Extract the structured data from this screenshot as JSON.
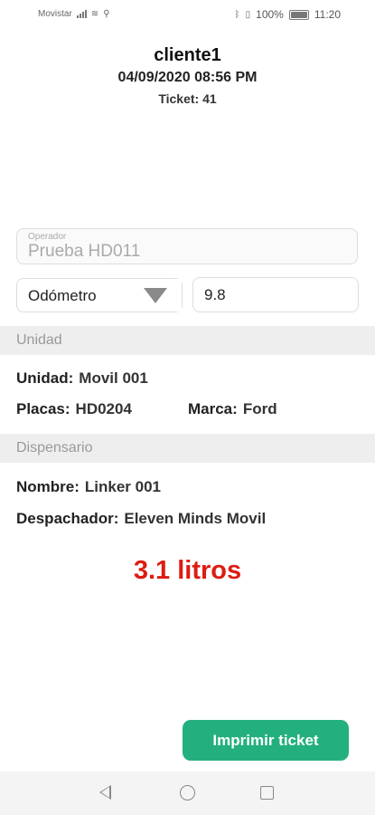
{
  "status_bar": {
    "carrier": "Movistar",
    "battery": "100%",
    "time": "11:20"
  },
  "header": {
    "client": "cliente1",
    "datetime": "04/09/2020 08:56 PM",
    "ticket": "Ticket: 41"
  },
  "operator": {
    "label": "Operador",
    "value": "Prueba HD011"
  },
  "odometer": {
    "selected": "Odómetro",
    "value": "9.8"
  },
  "unit_section": {
    "title": "Unidad",
    "unidad_label": "Unidad:",
    "unidad_value": "Movil 001",
    "placas_label": "Placas:",
    "placas_value": "HD0204",
    "marca_label": "Marca:",
    "marca_value": "Ford"
  },
  "dispenser_section": {
    "title": "Dispensario",
    "nombre_label": "Nombre:",
    "nombre_value": "Linker 001",
    "despachador_label": "Despachador:",
    "despachador_value": "Eleven Minds Movil"
  },
  "liters": "3.1 litros",
  "print_button": "Imprimir ticket",
  "colors": {
    "accent_button": "#23b07e",
    "liters_text": "#dd1c12",
    "section_header_bg": "#eeeeee"
  },
  "icons": {
    "nav_back": "back-triangle-icon",
    "nav_home": "home-circle-icon",
    "nav_recent": "recent-apps-square-icon",
    "dropdown": "dropdown-triangle-icon"
  }
}
